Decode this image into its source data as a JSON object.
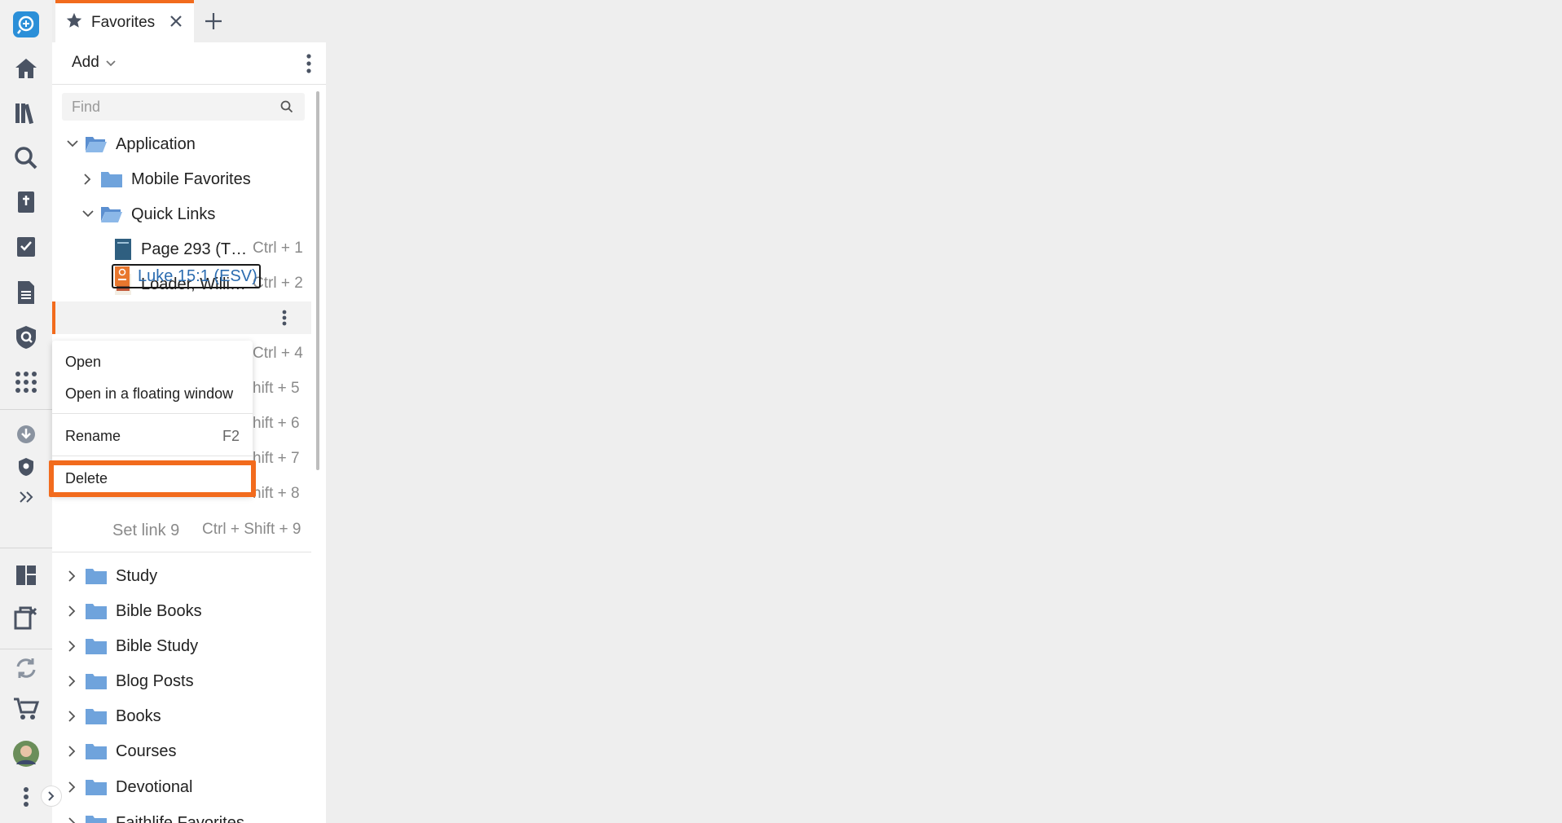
{
  "tab": {
    "title": "Favorites"
  },
  "toolbar": {
    "add_label": "Add"
  },
  "search": {
    "placeholder": "Find"
  },
  "tree": {
    "application": "Application",
    "mobile_favorites": "Mobile Favorites",
    "quick_links": "Quick Links",
    "links": [
      {
        "label": "Page 293 (T…",
        "shortcut": "Ctrl + 1"
      },
      {
        "label": "Loader, Willi…",
        "shortcut": "Ctrl + 2"
      },
      {
        "label": "Luke 15:1 (ESV)",
        "shortcut": ""
      },
      {
        "label": "",
        "shortcut": "Ctrl + 4"
      },
      {
        "label": "",
        "shortcut": "hift + 5"
      },
      {
        "label": "",
        "shortcut": "hift + 6"
      },
      {
        "label": "",
        "shortcut": "hift + 7"
      },
      {
        "label": "",
        "shortcut": "hift + 8"
      },
      {
        "label": "Set link 9",
        "shortcut": "Ctrl + Shift + 9"
      }
    ],
    "folders": [
      "Study",
      "Bible Books",
      "Bible Study",
      "Blog Posts",
      "Books",
      "Courses",
      "Devotional",
      "Faithlife Favorites"
    ]
  },
  "context_menu": {
    "open": "Open",
    "open_floating": "Open in a floating window",
    "rename": "Rename",
    "rename_key": "F2",
    "delete": "Delete"
  },
  "colors": {
    "accent": "#f26b1d",
    "folder": "#6fa3dc",
    "link": "#2b6cb0"
  }
}
